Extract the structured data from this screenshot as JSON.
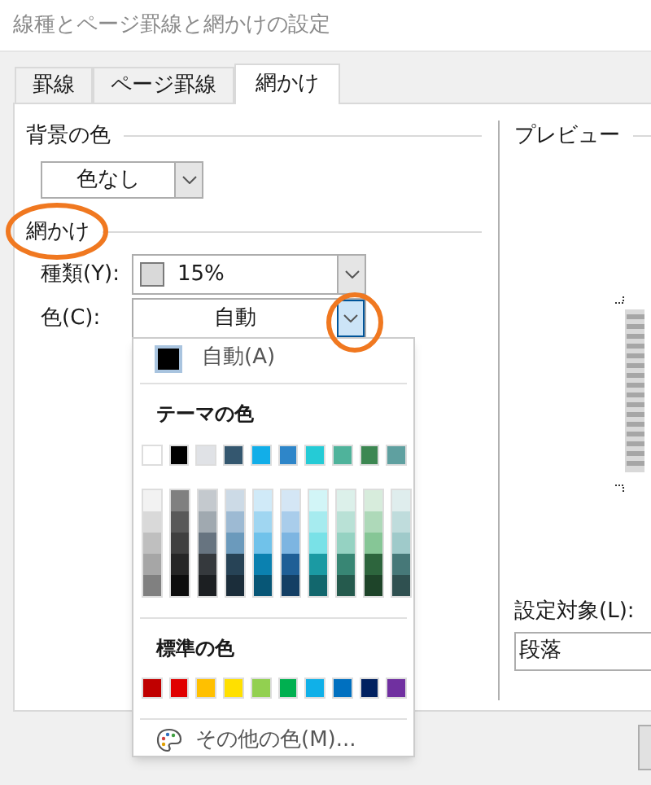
{
  "window": {
    "title": "線種とページ罫線と網かけの設定"
  },
  "tabs": [
    {
      "label": "罫線",
      "selected": false
    },
    {
      "label": "ページ罫線",
      "selected": false
    },
    {
      "label": "網かけ",
      "selected": true
    }
  ],
  "background": {
    "heading": "背景の色",
    "value": "色なし"
  },
  "shading": {
    "heading": "網かけ",
    "style_label": "種類(Y):",
    "style_value": "15%",
    "color_label": "色(C):",
    "color_value": "自動"
  },
  "preview": {
    "heading": "プレビュー",
    "apply_label": "設定対象(L):",
    "apply_value": "段落"
  },
  "color_menu": {
    "automatic": "自動(A)",
    "theme_heading": "テーマの色",
    "theme_colors": [
      {
        "color": "#ffffff",
        "shades": [
          {
            "color": "#f2f2f2"
          },
          {
            "color": "#d9d9d9"
          },
          {
            "color": "#bfbfbf"
          },
          {
            "color": "#a6a6a6"
          },
          {
            "color": "#808080"
          }
        ]
      },
      {
        "color": "#000000",
        "shades": [
          {
            "color": "#808080"
          },
          {
            "color": "#595959"
          },
          {
            "color": "#404040"
          },
          {
            "color": "#262626"
          },
          {
            "color": "#0d0d0d"
          }
        ]
      },
      {
        "color": "#e0e2e6",
        "shades": [
          {
            "color": "#c4c9ce"
          },
          {
            "color": "#a0a9b0"
          },
          {
            "color": "#677480"
          },
          {
            "color": "#35393d"
          },
          {
            "color": "#1c1f22"
          }
        ]
      },
      {
        "color": "#34576f",
        "shades": [
          {
            "color": "#ccdae6"
          },
          {
            "color": "#9dbad3"
          },
          {
            "color": "#6b9abc"
          },
          {
            "color": "#274356"
          },
          {
            "color": "#1b2d3a"
          }
        ]
      },
      {
        "color": "#12aee8",
        "shades": [
          {
            "color": "#d0eaf8"
          },
          {
            "color": "#a0d6f1"
          },
          {
            "color": "#70c2ea"
          },
          {
            "color": "#0b81b0"
          },
          {
            "color": "#075676"
          }
        ]
      },
      {
        "color": "#2e86c9",
        "shades": [
          {
            "color": "#d4e6f5"
          },
          {
            "color": "#a9cdeb"
          },
          {
            "color": "#7db5e1"
          },
          {
            "color": "#1f5f96"
          },
          {
            "color": "#143f64"
          }
        ]
      },
      {
        "color": "#25cbd6",
        "shades": [
          {
            "color": "#d2f5f7"
          },
          {
            "color": "#a6ebef"
          },
          {
            "color": "#79e1e7"
          },
          {
            "color": "#1b9aa3"
          },
          {
            "color": "#12676d"
          }
        ]
      },
      {
        "color": "#4fb39b",
        "shades": [
          {
            "color": "#dcf0ea"
          },
          {
            "color": "#b9e1d6"
          },
          {
            "color": "#95d2c2"
          },
          {
            "color": "#388674"
          },
          {
            "color": "#255a4d"
          }
        ]
      },
      {
        "color": "#3c8752",
        "shades": [
          {
            "color": "#d7ecdc"
          },
          {
            "color": "#aed9b9"
          },
          {
            "color": "#86c696"
          },
          {
            "color": "#2d653d"
          },
          {
            "color": "#1e4429"
          }
        ]
      },
      {
        "color": "#5fa0a0",
        "shades": [
          {
            "color": "#dfeded"
          },
          {
            "color": "#bfdcdc"
          },
          {
            "color": "#9fcaca"
          },
          {
            "color": "#467878"
          },
          {
            "color": "#2f5050"
          }
        ]
      }
    ],
    "standard_heading": "標準の色",
    "standard_colors": [
      {
        "color": "#c00000"
      },
      {
        "color": "#e00000"
      },
      {
        "color": "#ffc000"
      },
      {
        "color": "#ffe000"
      },
      {
        "color": "#92d050"
      },
      {
        "color": "#00b050"
      },
      {
        "color": "#10b0e8"
      },
      {
        "color": "#0070c0"
      },
      {
        "color": "#002060"
      },
      {
        "color": "#7030a0"
      }
    ],
    "more": "その他の色(M)..."
  }
}
